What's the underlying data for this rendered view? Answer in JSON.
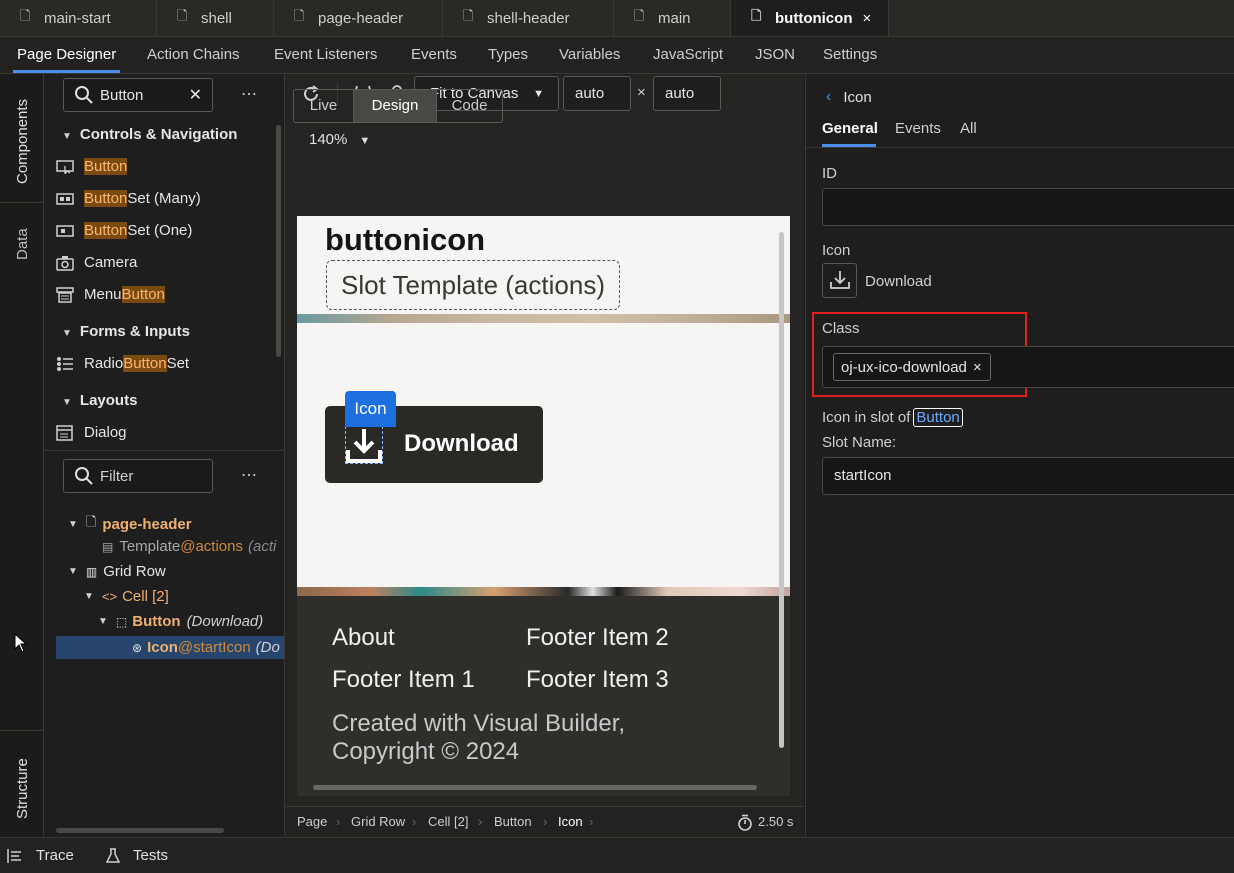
{
  "file_tabs": [
    {
      "label": "main-start",
      "icon": "file-icon"
    },
    {
      "label": "shell",
      "icon": "file-icon"
    },
    {
      "label": "page-header",
      "icon": "file-icon"
    },
    {
      "label": "shell-header",
      "icon": "file-icon"
    },
    {
      "label": "main",
      "icon": "file-icon"
    },
    {
      "label": "buttonicon",
      "icon": "file-icon",
      "active": true,
      "close": "×"
    }
  ],
  "designer_tabs": [
    "Page Designer",
    "Action Chains",
    "Event Listeners",
    "Events",
    "Types",
    "Variables",
    "JavaScript",
    "JSON",
    "Settings"
  ],
  "rail": {
    "components": "Components",
    "data": "Data",
    "structure": "Structure"
  },
  "components": {
    "search_value": "Button",
    "search_clear": "✕",
    "more": "⋯",
    "sections": [
      {
        "title": "Controls & Navigation",
        "items": [
          {
            "pre": "",
            "match": "Button",
            "post": "",
            "icon": "button-icon"
          },
          {
            "pre": "",
            "match": "Button",
            "post": " Set (Many)",
            "icon": "button-set-icon"
          },
          {
            "pre": "",
            "match": "Button",
            "post": " Set (One)",
            "icon": "button-set-one-icon"
          },
          {
            "pre": "Camera",
            "match": "",
            "post": "",
            "icon": "camera-icon"
          },
          {
            "pre": "Menu ",
            "match": "Button",
            "post": "",
            "icon": "menu-button-icon"
          }
        ]
      },
      {
        "title": "Forms & Inputs",
        "items": [
          {
            "pre": "Radio ",
            "match": "Button",
            "post": " Set",
            "icon": "radio-list-icon"
          }
        ]
      },
      {
        "title": "Layouts",
        "items": [
          {
            "pre": "Dialog",
            "match": "",
            "post": "",
            "icon": "dialog-icon"
          }
        ]
      }
    ]
  },
  "structure": {
    "filter_placeholder": "Filter",
    "more": "⋯",
    "nodes": {
      "page_header": "page-header",
      "template": "Template",
      "template_slot": "@actions",
      "template_extra": "(acti",
      "grid_row": "Grid Row",
      "cell": "Cell [2]",
      "button": "Button",
      "button_extra": "(Download)",
      "icon": "Icon",
      "icon_slot": "@startIcon",
      "icon_extra": "(Do"
    }
  },
  "canvas_toolbar": {
    "fit": "Fit to Canvas",
    "width": "auto",
    "height": "auto",
    "times": "×",
    "zoom": "140%",
    "modes": [
      "Live",
      "Design",
      "Code"
    ],
    "active_mode": "Design"
  },
  "canvas": {
    "page_title": "buttonicon",
    "slot_template": "Slot Template (actions)",
    "icon_badge": "Icon",
    "button_label": "Download",
    "footer": {
      "col1": [
        "About",
        "Footer Item 1"
      ],
      "col2": [
        "Footer Item 2",
        "Footer Item 3"
      ],
      "credit_line1": "Created with Visual Builder,",
      "credit_line2": "Copyright © 2024"
    }
  },
  "breadcrumbs": [
    "Page",
    "Grid Row",
    "Cell [2]",
    "Button",
    "Icon"
  ],
  "timer": "2.50 s",
  "properties": {
    "back_label": "Icon",
    "tabs": [
      "General",
      "Events",
      "All"
    ],
    "active_tab": "General",
    "id_label": "ID",
    "id_value": "",
    "icon_label": "Icon",
    "icon_value": "Download",
    "class_label": "Class",
    "class_chip": "oj-ux-ico-download",
    "chip_remove": "×",
    "slot_prefix": "Icon in slot of",
    "slot_link": "Button",
    "slot_name_label": "Slot Name:",
    "slot_name_value": "startIcon"
  },
  "bottom_bar": {
    "trace": "Trace",
    "tests": "Tests"
  },
  "colors": {
    "accent": "#4a8ef0",
    "highlight_box": "#e0201e",
    "match_bg": "#7a4a10",
    "match_fg": "#ffb46a",
    "tree_orange": "#f0b070",
    "badge_blue": "#1e6fe0"
  }
}
